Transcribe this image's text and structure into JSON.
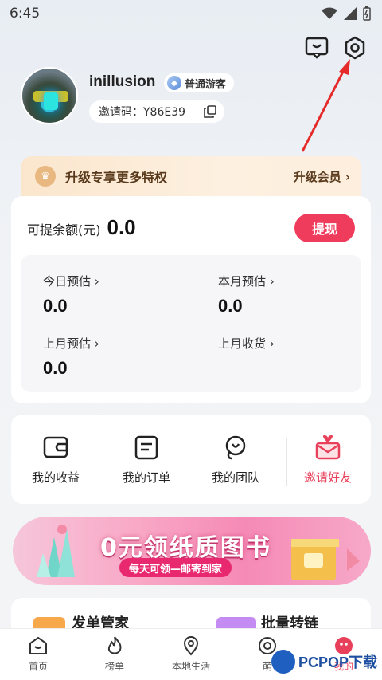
{
  "status_bar": {
    "time": "6:45"
  },
  "top_actions": [
    {
      "icon": "message-icon"
    },
    {
      "icon": "settings-icon"
    }
  ],
  "profile": {
    "username": "inillusion",
    "level": "普通游客",
    "invite_code": "邀请码：Y86E39"
  },
  "vip": {
    "title": "升级专享更多特权",
    "link": "升级会员 ›"
  },
  "balance": {
    "label": "可提余额(元)",
    "value": "0.0",
    "withdraw": "提现",
    "stats": [
      {
        "label": "今日预估 ›",
        "value": "0.0"
      },
      {
        "label": "本月预估 ›",
        "value": "0.0"
      },
      {
        "label": "上月预估 ›",
        "value": "0.0"
      },
      {
        "label": "上月收货 ›",
        "value": ""
      }
    ]
  },
  "menu": [
    {
      "label": "我的收益",
      "icon": "wallet-icon"
    },
    {
      "label": "我的订单",
      "icon": "order-icon"
    },
    {
      "label": "我的团队",
      "icon": "team-icon"
    },
    {
      "label": "邀请好友",
      "icon": "invite-icon"
    }
  ],
  "promo": {
    "title": "0元领纸质图书",
    "subtitle": "每天可领—邮寄到家"
  },
  "bottom_cards": [
    {
      "title": "发单管家"
    },
    {
      "title": "批量转链"
    }
  ],
  "tabbar": [
    {
      "label": "首页",
      "icon": "home-icon"
    },
    {
      "label": "榜单",
      "icon": "flame-icon"
    },
    {
      "label": "本地生活",
      "icon": "location-icon"
    },
    {
      "label": "萌",
      "icon": "cute-icon"
    },
    {
      "label": "我的",
      "icon": "profile-icon"
    }
  ],
  "watermark": {
    "text": "PCPOP下载"
  },
  "colors": {
    "accent": "#ef3c5c",
    "vip_brown": "#5a3a1c",
    "pink": "#f58ab6"
  }
}
